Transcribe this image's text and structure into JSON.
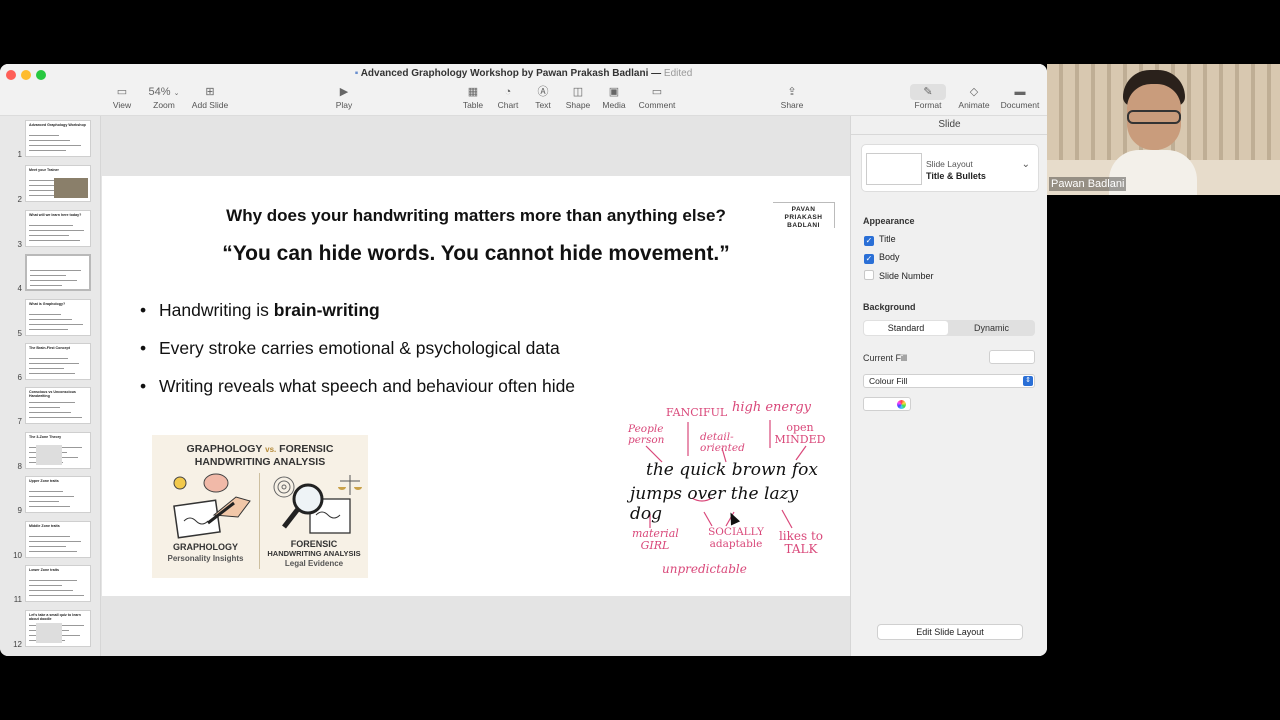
{
  "window": {
    "title": "Advanced Graphology Workshop by Pawan Prakash Badlani",
    "status": "Edited"
  },
  "toolbar": {
    "view": "View",
    "zoom_value": "54%",
    "zoom": "Zoom",
    "add_slide": "Add Slide",
    "play": "Play",
    "table": "Table",
    "chart": "Chart",
    "text": "Text",
    "shape": "Shape",
    "media": "Media",
    "comment": "Comment",
    "share": "Share",
    "format": "Format",
    "animate": "Animate",
    "document": "Document"
  },
  "slides": {
    "numbers": [
      "1",
      "2",
      "3",
      "4",
      "5",
      "6",
      "7",
      "8",
      "9",
      "10",
      "11",
      "12"
    ],
    "thumb_titles": [
      "Advanced Graphology Workshop",
      "Meet your Trainer",
      "What will we learn here today?",
      "",
      "What is Graphology?",
      "The Brain-First Concept",
      "Conscious vs Unconscious Handwriting",
      "The 3-Zone Theory",
      "Upper Zone traits",
      "Middle Zone traits",
      "Lower Zone traits",
      "Let's take a small quiz to learn about doodle"
    ]
  },
  "slide": {
    "question": "Why does your handwriting matters more than anything else?",
    "quote": "“You can hide words. You cannot hide movement.”",
    "logo": [
      "PAVAN",
      "PRIAKASH",
      "BADLANI"
    ],
    "bullets": [
      {
        "text": "Handwriting is ",
        "bold": "brain-writing"
      },
      {
        "text": "Every stroke carries emotional & psychological data"
      },
      {
        "text": "Writing reveals what speech and behaviour often hide"
      }
    ],
    "image_left": {
      "heading1": "GRAPHOLOGY",
      "vs": "vs.",
      "heading2": "FORENSIC",
      "heading3": "HANDWRITING ANALYSIS",
      "left_label": "GRAPHOLOGY",
      "left_sub": "Personality Insights",
      "right_label1": "FORENSIC",
      "right_label2": "HANDWRITING ANALYSIS",
      "right_sub": "Legal Evidence"
    },
    "image_right": {
      "sentence1": "the quick brown fox",
      "sentence2": "jumps over the lazy dog",
      "labels": [
        "FANCIFUL",
        "high energy",
        "People person",
        "detail-oriented",
        "open MINDED",
        "material GIRL",
        "SOCIALLY adaptable",
        "likes to TALK",
        "unpredictable"
      ]
    }
  },
  "inspector": {
    "tab": "Slide",
    "layout_label": "Slide Layout",
    "layout_name": "Title & Bullets",
    "appearance": "Appearance",
    "title_cb": "Title",
    "body_cb": "Body",
    "slide_number_cb": "Slide Number",
    "background": "Background",
    "standard": "Standard",
    "dynamic": "Dynamic",
    "current_fill": "Current Fill",
    "fill_type": "Colour Fill",
    "edit_layout": "Edit Slide Layout"
  },
  "video": {
    "name": "Pawan Badlani"
  },
  "colors": {
    "accent": "#2a6fd6",
    "handwriting": "#d9487a"
  }
}
